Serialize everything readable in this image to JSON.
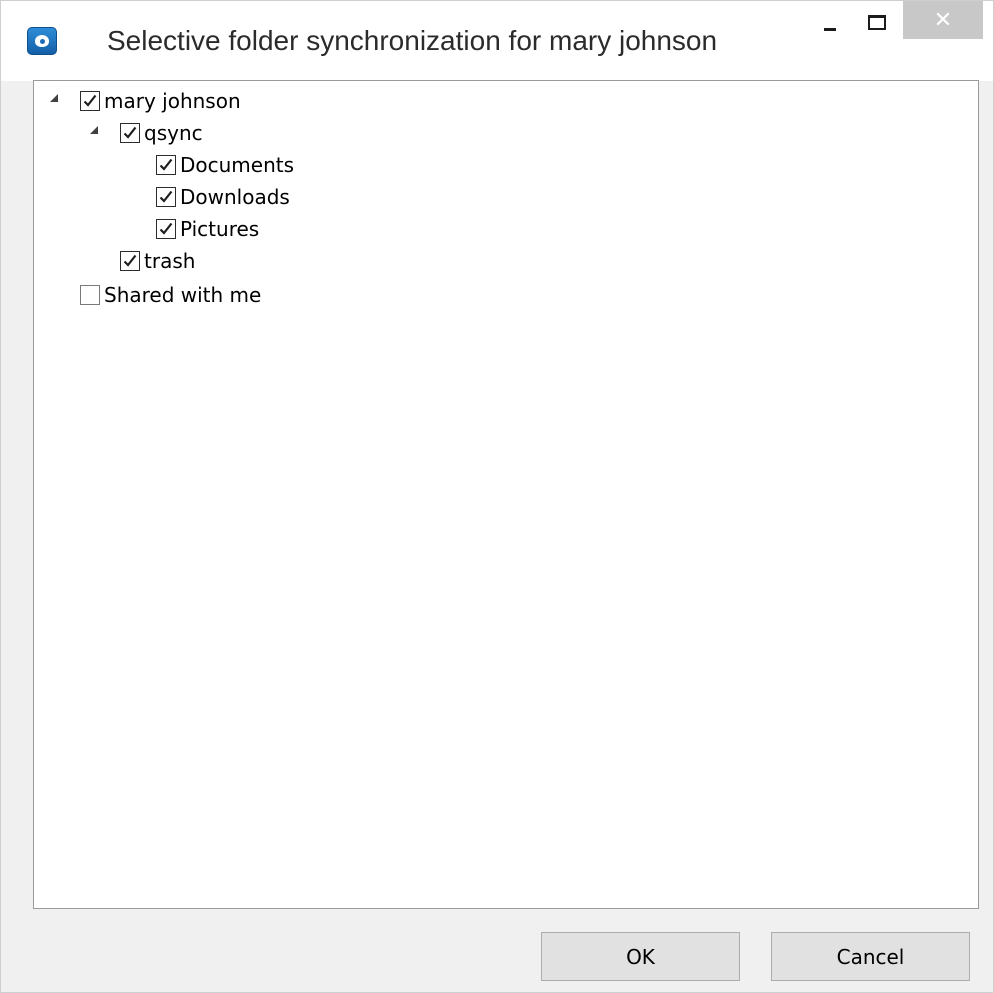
{
  "window": {
    "title": "Selective folder synchronization for mary johnson",
    "controls": {
      "minimize_icon": "minimize-icon",
      "maximize_icon": "maximize-icon",
      "close_label": "✕"
    }
  },
  "tree": {
    "nodes": [
      {
        "label": "mary johnson",
        "checked": true,
        "expanded": true
      },
      {
        "label": "qsync",
        "checked": true,
        "expanded": true
      },
      {
        "label": "Documents",
        "checked": true
      },
      {
        "label": "Downloads",
        "checked": true
      },
      {
        "label": "Pictures",
        "checked": true
      },
      {
        "label": "trash",
        "checked": true
      },
      {
        "label": "Shared with me",
        "checked": false
      }
    ]
  },
  "buttons": {
    "ok": "OK",
    "cancel": "Cancel"
  },
  "colors": {
    "titlebar": "#ffffff",
    "close_button": "#c8c8c8",
    "panel_border": "#9a9a9a",
    "button_face": "#e1e1e1"
  }
}
